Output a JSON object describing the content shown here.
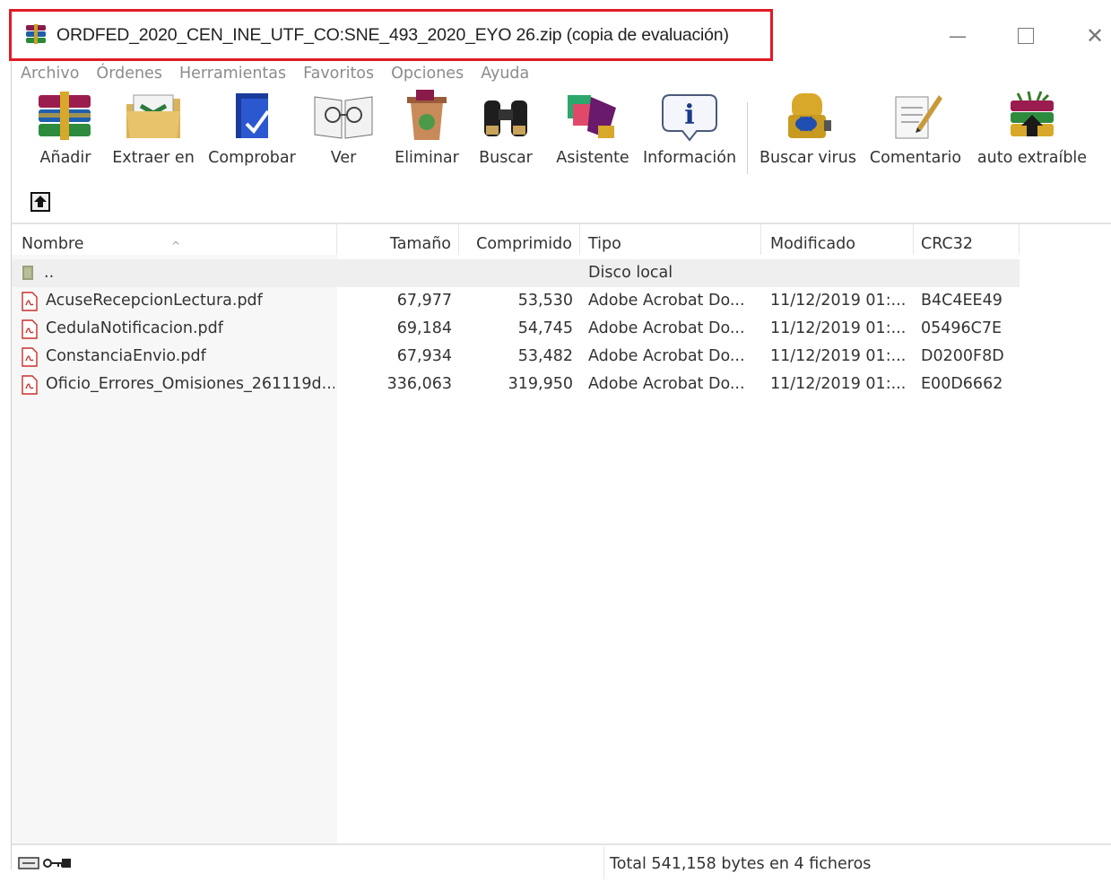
{
  "window": {
    "title": "ORDFED_2020_CEN_INE_UTF_CO:SNE_493_2020_EYO 26.zip (copia de evaluación)"
  },
  "menu": [
    "Archivo",
    "Órdenes",
    "Herramientas",
    "Favoritos",
    "Opciones",
    "Ayuda"
  ],
  "toolbar": {
    "add": "Añadir",
    "extract": "Extraer en",
    "test": "Comprobar",
    "view": "Ver",
    "delete": "Eliminar",
    "find": "Buscar",
    "wizard": "Asistente",
    "info": "Información",
    "virus": "Buscar virus",
    "comment": "Comentario",
    "sfx": "auto extraíble"
  },
  "columns": {
    "name": "Nombre",
    "size": "Tamaño",
    "packed": "Comprimido",
    "type": "Tipo",
    "modified": "Modificado",
    "crc": "CRC32"
  },
  "parent_row": {
    "name": "..",
    "type": "Disco local"
  },
  "files": [
    {
      "name": "AcuseRecepcionLectura.pdf",
      "size": "67,977",
      "packed": "53,530",
      "type": "Adobe Acrobat Do...",
      "modified": "11/12/2019 01:...",
      "crc": "B4C4EE49"
    },
    {
      "name": "CedulaNotificacion.pdf",
      "size": "69,184",
      "packed": "54,745",
      "type": "Adobe Acrobat Do...",
      "modified": "11/12/2019 01:...",
      "crc": "05496C7E"
    },
    {
      "name": "ConstanciaEnvio.pdf",
      "size": "67,934",
      "packed": "53,482",
      "type": "Adobe Acrobat Do...",
      "modified": "11/12/2019 01:...",
      "crc": "D0200F8D"
    },
    {
      "name": "Oficio_Errores_Omisiones_261119d...",
      "size": "336,063",
      "packed": "319,950",
      "type": "Adobe Acrobat Do...",
      "modified": "11/12/2019 01:...",
      "crc": "E00D6662"
    }
  ],
  "status": {
    "text": "Total 541,158 bytes en 4 ficheros"
  }
}
